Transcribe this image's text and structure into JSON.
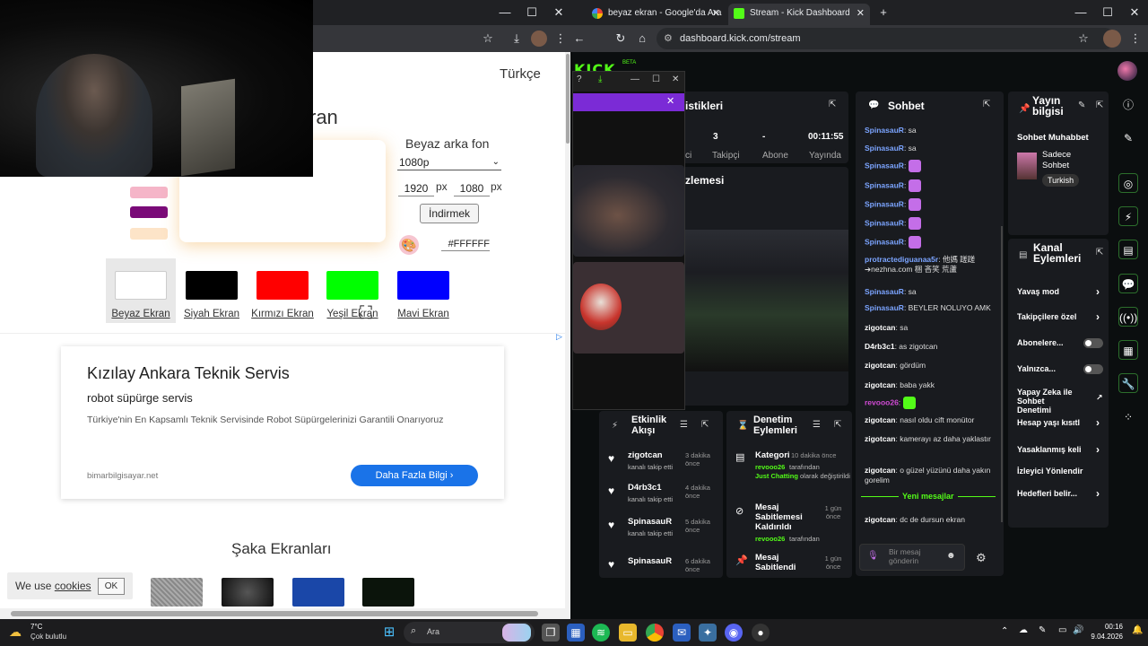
{
  "left_browser": {
    "page": {
      "language": "Türkçe",
      "title": "ran",
      "options_title": "Beyaz arka fon",
      "resolution": "1080p",
      "width": "1920",
      "height": "1080",
      "px_label": "px",
      "download_label": "İndirmek",
      "hex_value": "#FFFFFF",
      "colors": [
        {
          "label": "Beyaz Ekran",
          "color": "#ffffff"
        },
        {
          "label": "Siyah Ekran",
          "color": "#000000"
        },
        {
          "label": "Kırmızı Ekran",
          "color": "#ff0000"
        },
        {
          "label": "Yeşil Ekran",
          "color": "#00ff00"
        },
        {
          "label": "Mavi Ekran",
          "color": "#0000ff"
        }
      ],
      "mini_swatches": [
        "#f5b5c8",
        "#7a0a78",
        "#fde4c8"
      ]
    },
    "ad": {
      "title": "Kızılay Ankara Teknik Servis",
      "subtitle": "robot süpürge servis",
      "description": "Türkiye'nin En Kapsamlı Teknik Servisinde Robot Süpürgelerinizi Garantili Onarıyoruz",
      "domain": "bimarbilgisayar.net",
      "button": "Daha Fazla Bilgi"
    },
    "joke_title": "Şaka Ekranları",
    "cookie": {
      "text": "We use ",
      "link": "cookies",
      "ok": "OK"
    }
  },
  "right_browser": {
    "tabs": [
      {
        "title": "beyaz ekran - Google'da Ara"
      },
      {
        "title": "Stream - Kick Dashboard"
      }
    ],
    "url": "dashboard.kick.com/stream",
    "kick": {
      "logo": "KICK",
      "beta": "BETA",
      "stats_title": "istikleri",
      "stats": [
        {
          "value": "",
          "label": "ci"
        },
        {
          "value": "3",
          "label": "Takipçi"
        },
        {
          "value": "-",
          "label": "Abone"
        },
        {
          "value": "00:11:55",
          "label": "Yayında"
        }
      ],
      "preview_title": "zlemesi",
      "chat": {
        "title": "Sohbet",
        "messages": [
          {
            "user": "SpinasauR",
            "text": "sa",
            "color": "#7ba4ff"
          },
          {
            "user": "SpinasauR",
            "text": "sa",
            "color": "#7ba4ff"
          },
          {
            "user": "SpinasauR",
            "text": "",
            "color": "#7ba4ff"
          },
          {
            "user": "SpinasauR",
            "text": "",
            "color": "#7ba4ff"
          },
          {
            "user": "SpinasauR",
            "text": "",
            "color": "#7ba4ff"
          },
          {
            "user": "SpinasauR",
            "text": "",
            "color": "#7ba4ff"
          },
          {
            "user": "SpinasauR",
            "text": "",
            "color": "#7ba4ff"
          },
          {
            "user": "protractediguanaa5r",
            "text": "他媽 蹉蹉 ➔nezhna.com 梱 吝笑 荒蘆",
            "color": "#7ba4ff"
          },
          {
            "user": "SpinasauR",
            "text": "sa",
            "color": "#7ba4ff"
          },
          {
            "user": "SpinasauR",
            "text": "BEYLER NOLUYO AMK",
            "color": "#7ba4ff"
          },
          {
            "user": "zigotcan",
            "text": "sa",
            "color": "#ffffff"
          },
          {
            "user": "D4rb3c1",
            "text": "as zigotcan",
            "color": "#ffffff"
          },
          {
            "user": "zigotcan",
            "text": "gördüm",
            "color": "#ffffff"
          },
          {
            "user": "zigotcan",
            "text": "baba yakk",
            "color": "#ffffff"
          },
          {
            "user": "revooo26",
            "text": "",
            "color": "#d24bd6"
          },
          {
            "user": "zigotcan",
            "text": "nasıl oldu cift monütor",
            "color": "#ffffff"
          },
          {
            "user": "zigotcan",
            "text": "kamerayı az daha yaklastır",
            "color": "#ffffff"
          },
          {
            "user": "zigotcan",
            "text": "o güzel yüzünü daha yakın gorelim",
            "color": "#ffffff"
          },
          {
            "user": "zigotcan",
            "text": "dc de dursun ekran",
            "color": "#ffffff"
          }
        ],
        "new_messages": "Yeni mesajlar",
        "input_placeholder": "Bir mesaj gönderin"
      },
      "stream_info": {
        "title": "Yayın bilgisi",
        "chat_title": "Sohbet Muhabbet",
        "category": "Sadece Sohbet",
        "tag": "Turkish"
      },
      "activity": {
        "title": "Etkinlik Akışı",
        "items": [
          {
            "name": "zigotcan",
            "time": "3 dakika önce",
            "desc": "kanalı takip etti"
          },
          {
            "name": "D4rb3c1",
            "time": "4 dakika önce",
            "desc": "kanalı takip etti"
          },
          {
            "name": "SpinasauR",
            "time": "5 dakika önce",
            "desc": "kanalı takip etti"
          },
          {
            "name": "SpinasauR",
            "time": "6 dakika önce",
            "desc": ""
          }
        ]
      },
      "actions": {
        "title": "Denetim Eylemleri",
        "items": [
          {
            "title": "Kategori",
            "meta": "10 dakika önce",
            "detail1": "revooo26",
            "detail2": "tarafından",
            "detail3": "Just Chatting",
            "detail4": "olarak değiştirildi"
          },
          {
            "title": "Mesaj Sabitlemesi Kaldırıldı",
            "meta": "1 gün önce",
            "detail1": "revooo26",
            "detail2": "tarafından"
          },
          {
            "title": "Mesaj Sabitlendi",
            "meta": "1 gün önce"
          }
        ]
      },
      "channel_actions": {
        "title": "Kanal Eylemleri",
        "items": [
          {
            "label": "Yavaş mod",
            "type": "chevron"
          },
          {
            "label": "Takipçilere özel",
            "type": "chevron"
          },
          {
            "label": "Abonelere...",
            "type": "toggle"
          },
          {
            "label": "Yalnızca...",
            "type": "toggle"
          },
          {
            "label": "Yapay Zeka ile Sohbet Denetimi",
            "type": "external"
          },
          {
            "label": "Hesap yaşı kısıtl",
            "type": "chevron"
          },
          {
            "label": "Yasaklanmış keli",
            "type": "chevron"
          },
          {
            "label": "İzleyici Yönlendir",
            "type": "none"
          },
          {
            "label": "Hedefleri belir...",
            "type": "chevron"
          }
        ]
      }
    }
  },
  "taskbar": {
    "weather_temp": "7°C",
    "weather_desc": "Çok bulutlu",
    "search": "Ara",
    "time": "00:16",
    "date": "9.04.2026"
  },
  "colors": {
    "kick_green": "#53fc18",
    "ad_button": "#1a73e8",
    "chat_user": "#7ba4ff"
  }
}
